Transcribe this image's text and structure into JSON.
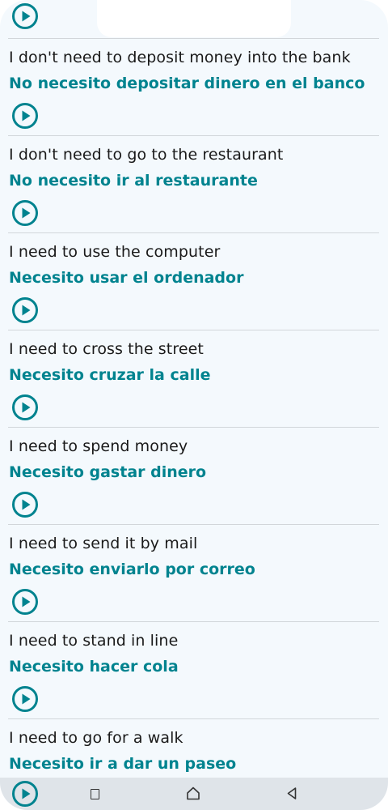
{
  "colors": {
    "accent": "#00838f",
    "text": "#1a1a1a",
    "background": "#f4f9fd",
    "divider": "#d2d6da",
    "navbar": "#dfe4e9"
  },
  "icons": {
    "play": "play-circle-icon",
    "recent": "recent-apps-icon",
    "home": "home-icon",
    "back": "back-icon"
  },
  "phrases": [
    {
      "en": "I don't need to deposit money into the bank",
      "es": "No necesito depositar dinero en el banco"
    },
    {
      "en": "I don't need to go to the restaurant",
      "es": "No necesito ir al restaurante"
    },
    {
      "en": "I need to use the computer",
      "es": "Necesito usar el ordenador"
    },
    {
      "en": "I need to cross the street",
      "es": "Necesito cruzar la calle"
    },
    {
      "en": "I need to spend money",
      "es": "Necesito gastar dinero"
    },
    {
      "en": "I need to send it by mail",
      "es": "Necesito enviarlo por correo"
    },
    {
      "en": "I need to stand in line",
      "es": "Necesito hacer cola"
    },
    {
      "en": "I need to go for a walk",
      "es": "Necesito ir a dar un paseo"
    }
  ]
}
